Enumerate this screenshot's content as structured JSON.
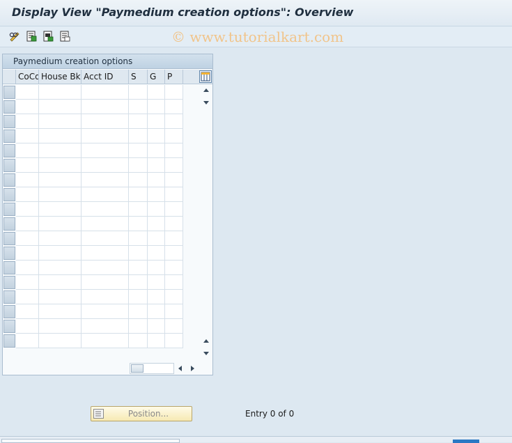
{
  "window": {
    "title": "Display View \"Paymedium creation options\": Overview"
  },
  "toolbar": {
    "buttons": [
      {
        "icon": "display-change-icon"
      },
      {
        "icon": "select-all-icon"
      },
      {
        "icon": "select-block-icon"
      },
      {
        "icon": "deselect-all-icon"
      }
    ]
  },
  "watermark": "© www.tutorialkart.com",
  "table": {
    "caption": "Paymedium creation options",
    "columns": [
      "CoCd",
      "House Bk",
      "Acct ID",
      "S",
      "G",
      "P"
    ],
    "rows": [],
    "settings_icon": "table-settings-icon"
  },
  "footer": {
    "position_button": "Position...",
    "entry_text": "Entry 0 of 0"
  },
  "colors": {
    "background": "#dde8f1",
    "title_text": "#203040",
    "watermark": "#f1c48a",
    "position_button": "#f6e9b3",
    "sap_blue": "#2a78c4"
  }
}
